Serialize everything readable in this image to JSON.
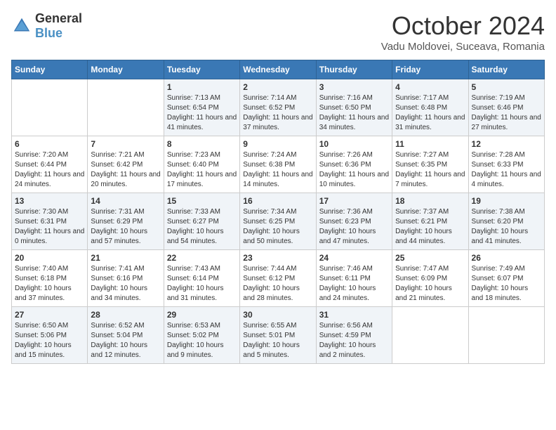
{
  "header": {
    "logo_general": "General",
    "logo_blue": "Blue",
    "month_title": "October 2024",
    "subtitle": "Vadu Moldovei, Suceava, Romania"
  },
  "days_of_week": [
    "Sunday",
    "Monday",
    "Tuesday",
    "Wednesday",
    "Thursday",
    "Friday",
    "Saturday"
  ],
  "weeks": [
    [
      {
        "day": "",
        "sunrise": "",
        "sunset": "",
        "daylight": ""
      },
      {
        "day": "",
        "sunrise": "",
        "sunset": "",
        "daylight": ""
      },
      {
        "day": "1",
        "sunrise": "Sunrise: 7:13 AM",
        "sunset": "Sunset: 6:54 PM",
        "daylight": "Daylight: 11 hours and 41 minutes."
      },
      {
        "day": "2",
        "sunrise": "Sunrise: 7:14 AM",
        "sunset": "Sunset: 6:52 PM",
        "daylight": "Daylight: 11 hours and 37 minutes."
      },
      {
        "day": "3",
        "sunrise": "Sunrise: 7:16 AM",
        "sunset": "Sunset: 6:50 PM",
        "daylight": "Daylight: 11 hours and 34 minutes."
      },
      {
        "day": "4",
        "sunrise": "Sunrise: 7:17 AM",
        "sunset": "Sunset: 6:48 PM",
        "daylight": "Daylight: 11 hours and 31 minutes."
      },
      {
        "day": "5",
        "sunrise": "Sunrise: 7:19 AM",
        "sunset": "Sunset: 6:46 PM",
        "daylight": "Daylight: 11 hours and 27 minutes."
      }
    ],
    [
      {
        "day": "6",
        "sunrise": "Sunrise: 7:20 AM",
        "sunset": "Sunset: 6:44 PM",
        "daylight": "Daylight: 11 hours and 24 minutes."
      },
      {
        "day": "7",
        "sunrise": "Sunrise: 7:21 AM",
        "sunset": "Sunset: 6:42 PM",
        "daylight": "Daylight: 11 hours and 20 minutes."
      },
      {
        "day": "8",
        "sunrise": "Sunrise: 7:23 AM",
        "sunset": "Sunset: 6:40 PM",
        "daylight": "Daylight: 11 hours and 17 minutes."
      },
      {
        "day": "9",
        "sunrise": "Sunrise: 7:24 AM",
        "sunset": "Sunset: 6:38 PM",
        "daylight": "Daylight: 11 hours and 14 minutes."
      },
      {
        "day": "10",
        "sunrise": "Sunrise: 7:26 AM",
        "sunset": "Sunset: 6:36 PM",
        "daylight": "Daylight: 11 hours and 10 minutes."
      },
      {
        "day": "11",
        "sunrise": "Sunrise: 7:27 AM",
        "sunset": "Sunset: 6:35 PM",
        "daylight": "Daylight: 11 hours and 7 minutes."
      },
      {
        "day": "12",
        "sunrise": "Sunrise: 7:28 AM",
        "sunset": "Sunset: 6:33 PM",
        "daylight": "Daylight: 11 hours and 4 minutes."
      }
    ],
    [
      {
        "day": "13",
        "sunrise": "Sunrise: 7:30 AM",
        "sunset": "Sunset: 6:31 PM",
        "daylight": "Daylight: 11 hours and 0 minutes."
      },
      {
        "day": "14",
        "sunrise": "Sunrise: 7:31 AM",
        "sunset": "Sunset: 6:29 PM",
        "daylight": "Daylight: 10 hours and 57 minutes."
      },
      {
        "day": "15",
        "sunrise": "Sunrise: 7:33 AM",
        "sunset": "Sunset: 6:27 PM",
        "daylight": "Daylight: 10 hours and 54 minutes."
      },
      {
        "day": "16",
        "sunrise": "Sunrise: 7:34 AM",
        "sunset": "Sunset: 6:25 PM",
        "daylight": "Daylight: 10 hours and 50 minutes."
      },
      {
        "day": "17",
        "sunrise": "Sunrise: 7:36 AM",
        "sunset": "Sunset: 6:23 PM",
        "daylight": "Daylight: 10 hours and 47 minutes."
      },
      {
        "day": "18",
        "sunrise": "Sunrise: 7:37 AM",
        "sunset": "Sunset: 6:21 PM",
        "daylight": "Daylight: 10 hours and 44 minutes."
      },
      {
        "day": "19",
        "sunrise": "Sunrise: 7:38 AM",
        "sunset": "Sunset: 6:20 PM",
        "daylight": "Daylight: 10 hours and 41 minutes."
      }
    ],
    [
      {
        "day": "20",
        "sunrise": "Sunrise: 7:40 AM",
        "sunset": "Sunset: 6:18 PM",
        "daylight": "Daylight: 10 hours and 37 minutes."
      },
      {
        "day": "21",
        "sunrise": "Sunrise: 7:41 AM",
        "sunset": "Sunset: 6:16 PM",
        "daylight": "Daylight: 10 hours and 34 minutes."
      },
      {
        "day": "22",
        "sunrise": "Sunrise: 7:43 AM",
        "sunset": "Sunset: 6:14 PM",
        "daylight": "Daylight: 10 hours and 31 minutes."
      },
      {
        "day": "23",
        "sunrise": "Sunrise: 7:44 AM",
        "sunset": "Sunset: 6:12 PM",
        "daylight": "Daylight: 10 hours and 28 minutes."
      },
      {
        "day": "24",
        "sunrise": "Sunrise: 7:46 AM",
        "sunset": "Sunset: 6:11 PM",
        "daylight": "Daylight: 10 hours and 24 minutes."
      },
      {
        "day": "25",
        "sunrise": "Sunrise: 7:47 AM",
        "sunset": "Sunset: 6:09 PM",
        "daylight": "Daylight: 10 hours and 21 minutes."
      },
      {
        "day": "26",
        "sunrise": "Sunrise: 7:49 AM",
        "sunset": "Sunset: 6:07 PM",
        "daylight": "Daylight: 10 hours and 18 minutes."
      }
    ],
    [
      {
        "day": "27",
        "sunrise": "Sunrise: 6:50 AM",
        "sunset": "Sunset: 5:06 PM",
        "daylight": "Daylight: 10 hours and 15 minutes."
      },
      {
        "day": "28",
        "sunrise": "Sunrise: 6:52 AM",
        "sunset": "Sunset: 5:04 PM",
        "daylight": "Daylight: 10 hours and 12 minutes."
      },
      {
        "day": "29",
        "sunrise": "Sunrise: 6:53 AM",
        "sunset": "Sunset: 5:02 PM",
        "daylight": "Daylight: 10 hours and 9 minutes."
      },
      {
        "day": "30",
        "sunrise": "Sunrise: 6:55 AM",
        "sunset": "Sunset: 5:01 PM",
        "daylight": "Daylight: 10 hours and 5 minutes."
      },
      {
        "day": "31",
        "sunrise": "Sunrise: 6:56 AM",
        "sunset": "Sunset: 4:59 PM",
        "daylight": "Daylight: 10 hours and 2 minutes."
      },
      {
        "day": "",
        "sunrise": "",
        "sunset": "",
        "daylight": ""
      },
      {
        "day": "",
        "sunrise": "",
        "sunset": "",
        "daylight": ""
      }
    ]
  ]
}
